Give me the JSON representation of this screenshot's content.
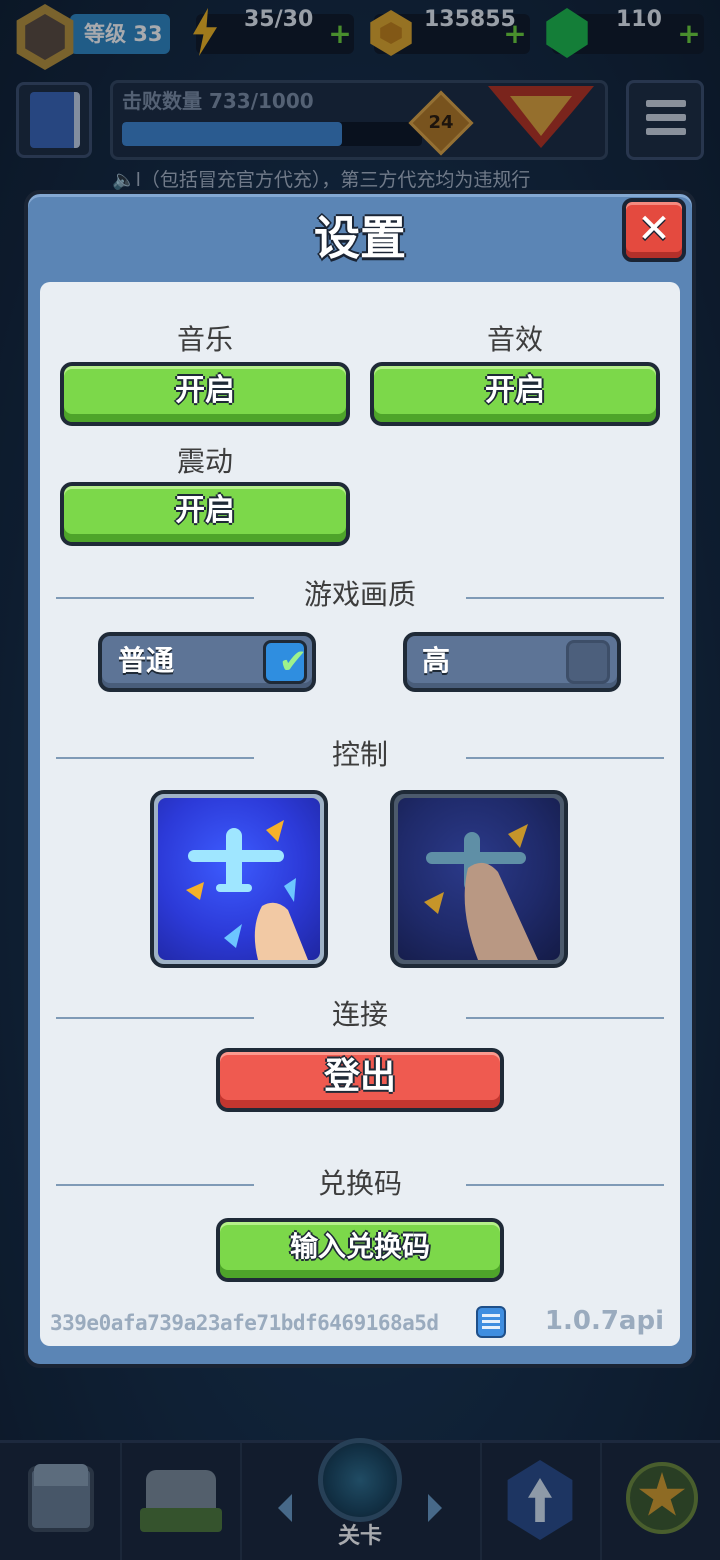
{
  "topbar": {
    "level_label": "等级 33",
    "energy": "35/30",
    "coins": "135855",
    "gems": "110"
  },
  "progress": {
    "label": "击败数量 733/1000",
    "fraction": 0.733,
    "badge": "24"
  },
  "notice": "🔈l（包括冒充官方代充），第三方代充均为违规行",
  "settings": {
    "title": "设置",
    "close_symbol": "✕",
    "music_label": "音乐",
    "music_value": "开启",
    "sfx_label": "音效",
    "sfx_value": "开启",
    "vibration_label": "震动",
    "vibration_value": "开启",
    "quality_title": "游戏画质",
    "quality_normal": "普通",
    "quality_high": "高",
    "quality_selected": "普通",
    "check_symbol": "✔",
    "control_title": "控制",
    "connection_title": "连接",
    "logout_label": "登出",
    "redeem_title": "兑换码",
    "redeem_button": "输入兑换码",
    "user_id": "339e0afa739a23afe71bdf6469168a5d",
    "version": "1.0.7api"
  },
  "bottom_nav": {
    "center_label": "关卡"
  },
  "icons": {
    "energy": "lightning-icon",
    "coin": "coin-icon",
    "gem": "gem-icon",
    "copy": "copy-icon",
    "close": "close-icon"
  },
  "colors": {
    "toggle_on": "#7cd84a",
    "logout": "#ef5a50",
    "modal_frame": "#5b85b5",
    "panel": "#e9eef3"
  }
}
